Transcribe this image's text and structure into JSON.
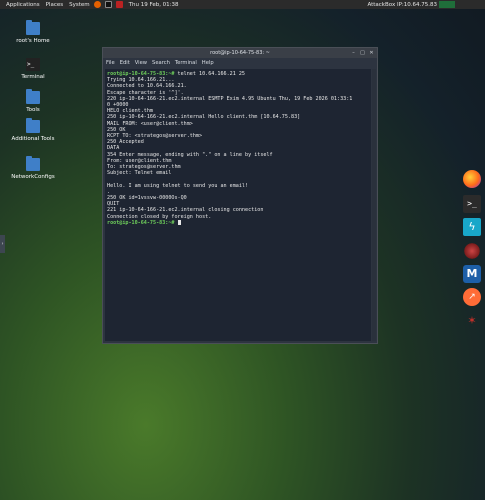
{
  "top_panel": {
    "menus": [
      "Applications",
      "Places",
      "System"
    ],
    "clock": "Thu 19 Feb, 01:38",
    "attackbox_ip": "AttackBox IP:10.64.75.83"
  },
  "desktop_icons": [
    {
      "label": "root's Home"
    },
    {
      "label": "Terminal"
    },
    {
      "label": "Tools"
    },
    {
      "label": "Additional Tools"
    },
    {
      "label": "NetworkConfigs"
    }
  ],
  "terminal": {
    "title": "root@ip-10-64-75-83: ~",
    "menu": [
      "File",
      "Edit",
      "View",
      "Search",
      "Terminal",
      "Help"
    ],
    "prompt": "root@ip-10-64-75-83:~#",
    "lines": [
      {
        "prompt": true,
        "text": " telnet 10.64.166.21 25"
      },
      {
        "text": "Trying 10.64.166.21..."
      },
      {
        "text": "Connected to 10.64.166.21."
      },
      {
        "text": "Escape character is '^]'."
      },
      {
        "text": "220 ip-10-64-166-21.ec2.internal ESMTP Exim 4.95 Ubuntu Thu, 19 Feb 2026 01:33:1"
      },
      {
        "text": "0 +0000"
      },
      {
        "text": "HELO client.thm"
      },
      {
        "text": "250 ip-10-64-166-21.ec2.internal Hello client.thm [10.64.75.83]"
      },
      {
        "text": "MAIL FROM: <user@client.thm>"
      },
      {
        "text": "250 OK"
      },
      {
        "text": "RCPT TO: <strategos@server.thm>"
      },
      {
        "text": "250 Accepted"
      },
      {
        "text": "DATA"
      },
      {
        "text": "354 Enter message, ending with \".\" on a line by itself"
      },
      {
        "text": "From: user@client.thm"
      },
      {
        "text": "To: strategos@server.thm"
      },
      {
        "text": "Subject: Telnet email"
      },
      {
        "text": ""
      },
      {
        "text": "Hello. I am using telnet to send you an email!"
      },
      {
        "text": "."
      },
      {
        "text": "250 OK id=1vssvw-0000Os-Q0"
      },
      {
        "text": "QUIT"
      },
      {
        "text": "221 ip-10-64-166-21.ec2.internal closing connection"
      },
      {
        "text": "Connection closed by foreign host."
      },
      {
        "prompt": true,
        "text": " ",
        "cursor": true
      }
    ]
  },
  "dock": [
    "firefox-icon",
    "terminal-icon",
    "burpsuite-icon",
    "wireshark-icon",
    "metasploit-icon",
    "postman-icon",
    "network-tool-icon"
  ],
  "colors": {
    "prompt": "#6fcf5b",
    "terminal_bg": "#1e2532",
    "folder": "#3f7fc8"
  }
}
